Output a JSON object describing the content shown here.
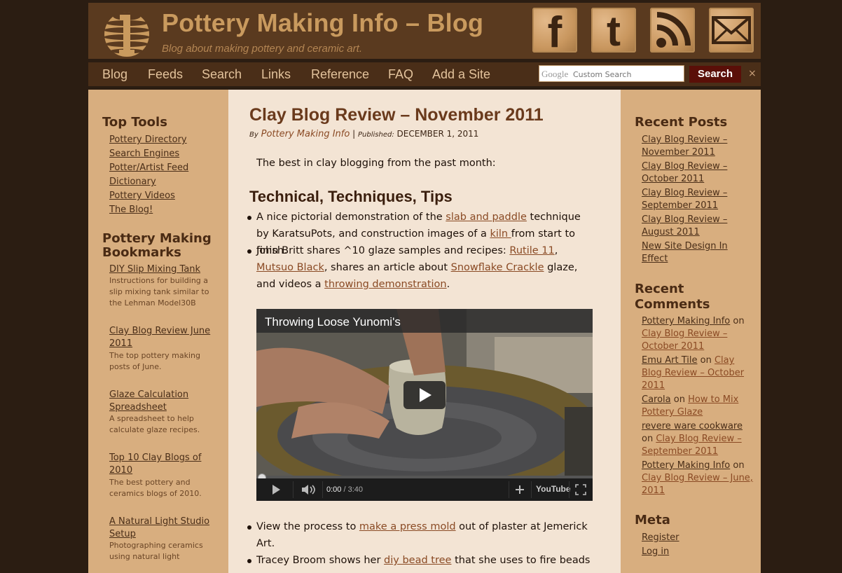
{
  "header": {
    "title": "Pottery Making Info – Blog",
    "tagline": "Blog about making pottery and ceramic art.",
    "social": [
      "facebook-icon",
      "twitter-icon",
      "rss-icon",
      "email-icon"
    ],
    "social_labels": [
      "f",
      "t"
    ]
  },
  "nav": {
    "items": [
      "Blog",
      "Feeds",
      "Search",
      "Links",
      "Reference",
      "FAQ",
      "Add a Site"
    ],
    "search_placeholder": "Custom Search",
    "search_brand": "Google",
    "search_button": "Search",
    "close": "×"
  },
  "left": {
    "top_tools_heading": "Top Tools",
    "top_tools": [
      "Pottery Directory",
      "Search Engines",
      "Potter/Artist Feed",
      "Dictionary",
      "Pottery Videos",
      "The Blog!"
    ],
    "bookmarks_heading": "Pottery Making Bookmarks",
    "bookmarks": [
      {
        "title": "DIY Slip Mixing Tank",
        "desc": "Instructions for building a slip mixing tank similar to the Lehman Model30B"
      },
      {
        "title": "Clay Blog Review June 2011",
        "desc": "The top pottery making posts of June."
      },
      {
        "title": "Glaze Calculation Spreadsheet",
        "desc": "A spreadsheet to help calculate glaze recipes."
      },
      {
        "title": "Top 10 Clay Blogs of 2010",
        "desc": "The best pottery and ceramics blogs of 2010."
      },
      {
        "title": "A Natural Light Studio Setup",
        "desc": "Photographing ceramics using natural light"
      }
    ]
  },
  "post": {
    "title": "Clay Blog Review – November 2011",
    "by": "By",
    "author": "Pottery Making Info",
    "published_label": "Published:",
    "date": "DECEMBER 1, 2011",
    "intro": "The best in clay blogging from the past month:",
    "section": "Technical, Techniques, Tips",
    "b1": {
      "t1": "A nice pictorial demonstration of the ",
      "l1": "slab and paddle",
      "t2": " technique by KaratsuPots, and construction images of a ",
      "l2": "kiln ",
      "t3": "from start to finish."
    },
    "b2": {
      "t1": "John Britt shares ^10 glaze samples and recipes: ",
      "l1": "Rutile 11",
      "t2": ", ",
      "l2": "Mutsuo Black",
      "t3": ", shares an article about ",
      "l3": "Snowflake Crackle",
      "t4": " glaze, and videos a ",
      "l4": "throwing demonstration",
      "t5": "."
    },
    "b3": {
      "t1": "View the process to ",
      "l1": "make a press mold",
      "t2": " out of plaster at Jemerick Art."
    },
    "b4": {
      "t1": "Tracey Broom shows her ",
      "l1": "diy bead tree",
      "t2": " that she uses to fire beads"
    }
  },
  "video": {
    "title": "Throwing Loose Yunomi's",
    "time_current": "0:00",
    "time_sep": " / ",
    "time_total": "3:40",
    "progress": 0,
    "youtube": "YouTube"
  },
  "right": {
    "recent_posts_heading": "Recent Posts",
    "recent_posts": [
      "Clay Blog Review – November 2011",
      "Clay Blog Review – October 2011",
      "Clay Blog Review – September 2011",
      "Clay Blog Review – August 2011",
      "New Site Design In Effect"
    ],
    "recent_comments_heading": "Recent Comments",
    "comments": [
      {
        "author": "Pottery Making Info",
        "on": "on",
        "post": "Clay Blog Review – October 2011"
      },
      {
        "author": "Emu Art Tile",
        "on": "on",
        "post": "Clay Blog Review – October 2011"
      },
      {
        "author": "Carola",
        "on": "on",
        "post": "How to Mix Pottery Glaze"
      },
      {
        "author": "revere ware cookware",
        "on": "on",
        "post": "Clay Blog Review – September 2011"
      },
      {
        "author": "Pottery Making Info",
        "on": "on",
        "post": "Clay Blog Review – June, 2011"
      }
    ],
    "meta_heading": "Meta",
    "meta": [
      "Register",
      "Log in"
    ]
  },
  "colors": {
    "header_bg": "#5a3a1f",
    "nav_bg": "#4a2e18",
    "sidebar_bg": "#d8ae7f",
    "content_bg": "#f3e4d4",
    "link": "#8a4a24",
    "search_button": "#5a0f08"
  }
}
